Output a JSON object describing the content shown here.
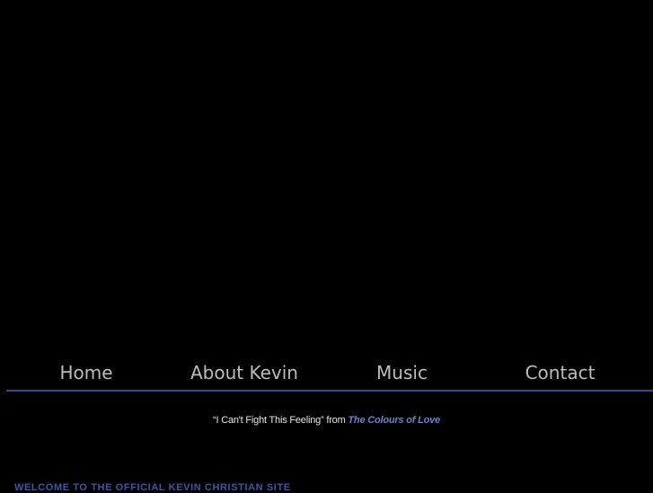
{
  "nav": {
    "items": [
      {
        "label": "Home"
      },
      {
        "label": "About Kevin"
      },
      {
        "label": "Music"
      },
      {
        "label": "Contact"
      }
    ]
  },
  "now_playing": {
    "song": "“I Can't Fight This Feeling” from",
    "album": "The Colours of Love"
  },
  "welcome": {
    "heading": "WELCOME TO THE OFFICIAL KEVIN CHRISTIAN SITE"
  },
  "colors": {
    "background": "#000000",
    "nav_text": "#bcbcbc",
    "divider": "#3f4a80",
    "accent": "#6b82c8",
    "heading": "#3d57a8"
  }
}
